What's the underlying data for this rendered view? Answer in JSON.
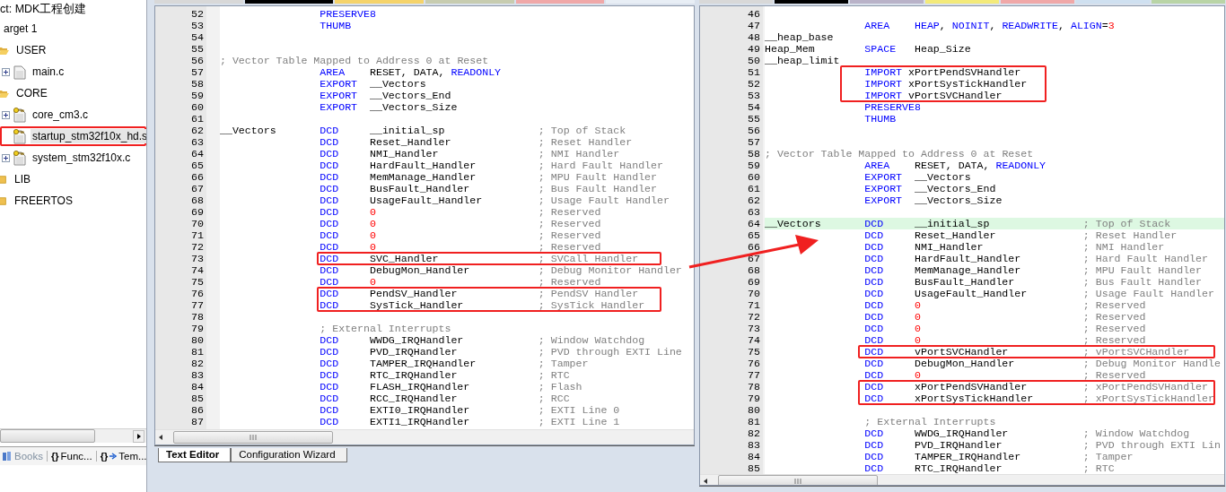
{
  "project": {
    "title": "ct: MDK工程创建",
    "tree": [
      {
        "label": "arget 1",
        "selected": false,
        "marked": false,
        "children": [
          {
            "label": "USER",
            "kind": "folder",
            "expanded": true,
            "selected": false,
            "marked": false,
            "children": [
              {
                "label": "main.c",
                "kind": "file",
                "expandable": true,
                "selected": false,
                "marked": false
              }
            ]
          },
          {
            "label": "CORE",
            "kind": "folder",
            "expanded": true,
            "selected": false,
            "marked": false,
            "children": [
              {
                "label": "core_cm3.c",
                "kind": "keyed_file",
                "expandable": true,
                "selected": false,
                "marked": false
              },
              {
                "label": "startup_stm32f10x_hd.s",
                "kind": "keyed_file",
                "expandable": false,
                "selected": true,
                "marked": true
              },
              {
                "label": "system_stm32f10x.c",
                "kind": "keyed_file",
                "expandable": true,
                "selected": false,
                "marked": false
              }
            ]
          },
          {
            "label": "LIB",
            "kind": "folder",
            "expanded": false,
            "selected": false,
            "marked": false
          },
          {
            "label": "FREERTOS",
            "kind": "folder",
            "expanded": false,
            "selected": false,
            "marked": false
          }
        ]
      }
    ],
    "tabs": [
      {
        "label": "Books",
        "kind": "books"
      },
      {
        "label": "Func...",
        "kind": "functions",
        "glyph": "{}"
      },
      {
        "label": "Tem...",
        "kind": "templates",
        "glyph": "{}"
      }
    ]
  },
  "editors": [
    {
      "file_tabs": [
        {
          "color": "#d8d8d8"
        },
        {
          "color": "#000000"
        },
        {
          "color": "#f5d36a"
        },
        {
          "color": "#c7ccb0"
        },
        {
          "color": "#f0a8a8"
        },
        {
          "color": "#e8eef5"
        }
      ],
      "lines": [
        {
          "num": "52",
          "kind": "code",
          "op": "PRESERVE8",
          "selected": false,
          "marked": false
        },
        {
          "num": "53",
          "kind": "code",
          "op": "THUMB",
          "selected": false,
          "marked": false
        },
        {
          "num": "54",
          "kind": "code",
          "selected": false,
          "marked": false
        },
        {
          "num": "55",
          "kind": "code",
          "selected": false,
          "marked": false
        },
        {
          "num": "56",
          "kind": "note",
          "comment": "; Vector Table Mapped to Address 0 at Reset",
          "selected": false,
          "marked": false
        },
        {
          "num": "57",
          "kind": "code",
          "op": "AREA",
          "args": [
            {
              "text": "RESET, DATA, ",
              "kind": "plain"
            },
            {
              "text": "READONLY",
              "kind": "keyword"
            }
          ],
          "selected": false,
          "marked": false
        },
        {
          "num": "58",
          "kind": "code",
          "op": "EXPORT",
          "args": [
            {
              "text": "__Vectors",
              "kind": "plain"
            }
          ],
          "selected": false,
          "marked": false
        },
        {
          "num": "59",
          "kind": "code",
          "op": "EXPORT",
          "args": [
            {
              "text": "__Vectors_End",
              "kind": "plain"
            }
          ],
          "selected": false,
          "marked": false
        },
        {
          "num": "60",
          "kind": "code",
          "op": "EXPORT",
          "args": [
            {
              "text": "__Vectors_Size",
              "kind": "plain"
            }
          ],
          "selected": false,
          "marked": false
        },
        {
          "num": "61",
          "kind": "code",
          "selected": false,
          "marked": false
        },
        {
          "num": "62",
          "kind": "code",
          "label": "__Vectors",
          "op": "DCD",
          "args": [
            {
              "text": "__initial_sp",
              "kind": "plain"
            }
          ],
          "comment": "; Top of Stack",
          "selected": false,
          "marked": false
        },
        {
          "num": "63",
          "kind": "code",
          "op": "DCD",
          "args": [
            {
              "text": "Reset_Handler",
              "kind": "plain"
            }
          ],
          "comment": "; Reset Handler",
          "selected": false,
          "marked": false
        },
        {
          "num": "64",
          "kind": "code",
          "op": "DCD",
          "args": [
            {
              "text": "NMI_Handler",
              "kind": "plain"
            }
          ],
          "comment": "; NMI Handler",
          "selected": false,
          "marked": false
        },
        {
          "num": "65",
          "kind": "code",
          "op": "DCD",
          "args": [
            {
              "text": "HardFault_Handler",
              "kind": "plain"
            }
          ],
          "comment": "; Hard Fault Handler",
          "selected": false,
          "marked": false
        },
        {
          "num": "66",
          "kind": "code",
          "op": "DCD",
          "args": [
            {
              "text": "MemManage_Handler",
              "kind": "plain"
            }
          ],
          "comment": "; MPU Fault Handler",
          "selected": false,
          "marked": false
        },
        {
          "num": "67",
          "kind": "code",
          "op": "DCD",
          "args": [
            {
              "text": "BusFault_Handler",
              "kind": "plain"
            }
          ],
          "comment": "; Bus Fault Handler",
          "selected": false,
          "marked": false
        },
        {
          "num": "68",
          "kind": "code",
          "op": "DCD",
          "args": [
            {
              "text": "UsageFault_Handler",
              "kind": "plain"
            }
          ],
          "comment": "; Usage Fault Handler",
          "selected": false,
          "marked": false
        },
        {
          "num": "69",
          "kind": "code",
          "op": "DCD",
          "args": [
            {
              "text": "0",
              "kind": "number"
            }
          ],
          "comment": "; Reserved",
          "selected": false,
          "marked": false
        },
        {
          "num": "70",
          "kind": "code",
          "op": "DCD",
          "args": [
            {
              "text": "0",
              "kind": "number"
            }
          ],
          "comment": "; Reserved",
          "selected": false,
          "marked": false
        },
        {
          "num": "71",
          "kind": "code",
          "op": "DCD",
          "args": [
            {
              "text": "0",
              "kind": "number"
            }
          ],
          "comment": "; Reserved",
          "selected": false,
          "marked": false
        },
        {
          "num": "72",
          "kind": "code",
          "op": "DCD",
          "args": [
            {
              "text": "0",
              "kind": "number"
            }
          ],
          "comment": "; Reserved",
          "selected": false,
          "marked": false
        },
        {
          "num": "73",
          "kind": "code",
          "op": "DCD",
          "args": [
            {
              "text": "SVC_Handler",
              "kind": "plain"
            }
          ],
          "comment": "; SVCall Handler",
          "selected": false,
          "marked": true
        },
        {
          "num": "74",
          "kind": "code",
          "op": "DCD",
          "args": [
            {
              "text": "DebugMon_Handler",
              "kind": "plain"
            }
          ],
          "comment": "; Debug Monitor Handler",
          "selected": false,
          "marked": false
        },
        {
          "num": "75",
          "kind": "code",
          "op": "DCD",
          "args": [
            {
              "text": "0",
              "kind": "number"
            }
          ],
          "comment": "; Reserved",
          "selected": false,
          "marked": false
        },
        {
          "num": "76",
          "kind": "code",
          "op": "DCD",
          "args": [
            {
              "text": "PendSV_Handler",
              "kind": "plain"
            }
          ],
          "comment": "; PendSV Handler",
          "selected": false,
          "marked": true
        },
        {
          "num": "77",
          "kind": "code",
          "op": "DCD",
          "args": [
            {
              "text": "SysTick_Handler",
              "kind": "plain"
            }
          ],
          "comment": "; SysTick Handler",
          "selected": false,
          "marked": true
        },
        {
          "num": "78",
          "kind": "code",
          "selected": false,
          "marked": false
        },
        {
          "num": "79",
          "kind": "indented_note",
          "comment": "; External Interrupts",
          "selected": false,
          "marked": false
        },
        {
          "num": "80",
          "kind": "code",
          "op": "DCD",
          "args": [
            {
              "text": "WWDG_IRQHandler",
              "kind": "plain"
            }
          ],
          "comment": "; Window Watchdog",
          "selected": false,
          "marked": false
        },
        {
          "num": "81",
          "kind": "code",
          "op": "DCD",
          "args": [
            {
              "text": "PVD_IRQHandler",
              "kind": "plain"
            }
          ],
          "comment": "; PVD through EXTI Line",
          "selected": false,
          "marked": false
        },
        {
          "num": "82",
          "kind": "code",
          "op": "DCD",
          "args": [
            {
              "text": "TAMPER_IRQHandler",
              "kind": "plain"
            }
          ],
          "comment": "; Tamper",
          "selected": false,
          "marked": false
        },
        {
          "num": "83",
          "kind": "code",
          "op": "DCD",
          "args": [
            {
              "text": "RTC_IRQHandler",
              "kind": "plain"
            }
          ],
          "comment": "; RTC",
          "selected": false,
          "marked": false
        },
        {
          "num": "84",
          "kind": "code",
          "op": "DCD",
          "args": [
            {
              "text": "FLASH_IRQHandler",
              "kind": "plain"
            }
          ],
          "comment": "; Flash",
          "selected": false,
          "marked": false
        },
        {
          "num": "85",
          "kind": "code",
          "op": "DCD",
          "args": [
            {
              "text": "RCC_IRQHandler",
              "kind": "plain"
            }
          ],
          "comment": "; RCC",
          "selected": false,
          "marked": false
        },
        {
          "num": "86",
          "kind": "code",
          "op": "DCD",
          "args": [
            {
              "text": "EXTI0_IRQHandler",
              "kind": "plain"
            }
          ],
          "comment": "; EXTI Line 0",
          "selected": false,
          "marked": false
        },
        {
          "num": "87",
          "kind": "code",
          "op": "DCD",
          "args": [
            {
              "text": "EXTI1_IRQHandler",
              "kind": "plain"
            }
          ],
          "comment": "; EXTI Line 1",
          "selected": false,
          "marked": false
        }
      ],
      "tabs": [
        {
          "label": "Text Editor",
          "selected": true
        },
        {
          "label": "Configuration Wizard",
          "selected": false
        }
      ]
    },
    {
      "file_tabs": [
        {
          "color": "#d8d8d8"
        },
        {
          "color": "#000000"
        },
        {
          "color": "#b9b2c8"
        },
        {
          "color": "#f3ea7a"
        },
        {
          "color": "#f0a8a8"
        },
        {
          "color": "#cfe0f0"
        },
        {
          "color": "#b9d4a6"
        }
      ],
      "lines": [
        {
          "num": "46",
          "kind": "code",
          "selected": false,
          "marked": false
        },
        {
          "num": "47",
          "kind": "code",
          "op": "AREA",
          "args": [
            {
              "text": "HEAP",
              "kind": "keyword"
            },
            {
              "text": ", ",
              "kind": "plain"
            },
            {
              "text": "NOINIT",
              "kind": "keyword"
            },
            {
              "text": ", ",
              "kind": "plain"
            },
            {
              "text": "READWRITE",
              "kind": "keyword"
            },
            {
              "text": ", ",
              "kind": "plain"
            },
            {
              "text": "ALIGN",
              "kind": "keyword"
            },
            {
              "text": "=",
              "kind": "plain"
            },
            {
              "text": "3",
              "kind": "number"
            }
          ],
          "selected": false,
          "marked": false
        },
        {
          "num": "48",
          "kind": "code",
          "label": "__heap_base",
          "selected": false,
          "marked": false
        },
        {
          "num": "49",
          "kind": "code",
          "label": "Heap_Mem",
          "op": "SPACE",
          "args": [
            {
              "text": "Heap_Size",
              "kind": "plain"
            }
          ],
          "selected": false,
          "marked": false
        },
        {
          "num": "50",
          "kind": "code",
          "label": "__heap_limit",
          "selected": false,
          "marked": false
        },
        {
          "num": "51",
          "kind": "import",
          "op": "IMPORT",
          "args": [
            {
              "text": "xPortPendSVHandler",
              "kind": "plain"
            }
          ],
          "selected": false,
          "marked": true
        },
        {
          "num": "52",
          "kind": "import",
          "op": "IMPORT",
          "args": [
            {
              "text": "xPortSysTickHandler",
              "kind": "plain"
            }
          ],
          "selected": false,
          "marked": true
        },
        {
          "num": "53",
          "kind": "import",
          "op": "IMPORT",
          "args": [
            {
              "text": "vPortSVCHandler",
              "kind": "plain"
            }
          ],
          "selected": false,
          "marked": true
        },
        {
          "num": "54",
          "kind": "code",
          "op": "PRESERVE8",
          "selected": false,
          "marked": false
        },
        {
          "num": "55",
          "kind": "code",
          "op": "THUMB",
          "selected": false,
          "marked": false
        },
        {
          "num": "56",
          "kind": "code",
          "selected": false,
          "marked": false
        },
        {
          "num": "57",
          "kind": "code",
          "selected": false,
          "marked": false
        },
        {
          "num": "58",
          "kind": "note",
          "comment": "; Vector Table Mapped to Address 0 at Reset",
          "selected": false,
          "marked": false
        },
        {
          "num": "59",
          "kind": "code",
          "op": "AREA",
          "args": [
            {
              "text": "RESET, DATA, ",
              "kind": "plain"
            },
            {
              "text": "READONLY",
              "kind": "keyword"
            }
          ],
          "selected": false,
          "marked": false
        },
        {
          "num": "60",
          "kind": "code",
          "op": "EXPORT",
          "args": [
            {
              "text": "__Vectors",
              "kind": "plain"
            }
          ],
          "selected": false,
          "marked": false
        },
        {
          "num": "61",
          "kind": "code",
          "op": "EXPORT",
          "args": [
            {
              "text": "__Vectors_End",
              "kind": "plain"
            }
          ],
          "selected": false,
          "marked": false
        },
        {
          "num": "62",
          "kind": "code",
          "op": "EXPORT",
          "args": [
            {
              "text": "__Vectors_Size",
              "kind": "plain"
            }
          ],
          "selected": false,
          "marked": false
        },
        {
          "num": "63",
          "kind": "code",
          "selected": false,
          "marked": false
        },
        {
          "num": "64",
          "kind": "code",
          "label": "__Vectors",
          "op": "DCD",
          "args": [
            {
              "text": "__initial_sp",
              "kind": "plain"
            }
          ],
          "comment": "; Top of Stack",
          "selected": true,
          "marked": false
        },
        {
          "num": "65",
          "kind": "code",
          "op": "DCD",
          "args": [
            {
              "text": "Reset_Handler",
              "kind": "plain"
            }
          ],
          "comment": "; Reset Handler",
          "selected": false,
          "marked": false
        },
        {
          "num": "66",
          "kind": "code",
          "op": "DCD",
          "args": [
            {
              "text": "NMI_Handler",
              "kind": "plain"
            }
          ],
          "comment": "; NMI Handler",
          "selected": false,
          "marked": false
        },
        {
          "num": "67",
          "kind": "code",
          "op": "DCD",
          "args": [
            {
              "text": "HardFault_Handler",
              "kind": "plain"
            }
          ],
          "comment": "; Hard Fault Handler",
          "selected": false,
          "marked": false
        },
        {
          "num": "68",
          "kind": "code",
          "op": "DCD",
          "args": [
            {
              "text": "MemManage_Handler",
              "kind": "plain"
            }
          ],
          "comment": "; MPU Fault Handler",
          "selected": false,
          "marked": false
        },
        {
          "num": "69",
          "kind": "code",
          "op": "DCD",
          "args": [
            {
              "text": "BusFault_Handler",
              "kind": "plain"
            }
          ],
          "comment": "; Bus Fault Handler",
          "selected": false,
          "marked": false
        },
        {
          "num": "70",
          "kind": "code",
          "op": "DCD",
          "args": [
            {
              "text": "UsageFault_Handler",
              "kind": "plain"
            }
          ],
          "comment": "; Usage Fault Handler",
          "selected": false,
          "marked": false
        },
        {
          "num": "71",
          "kind": "code",
          "op": "DCD",
          "args": [
            {
              "text": "0",
              "kind": "number"
            }
          ],
          "comment": "; Reserved",
          "selected": false,
          "marked": false
        },
        {
          "num": "72",
          "kind": "code",
          "op": "DCD",
          "args": [
            {
              "text": "0",
              "kind": "number"
            }
          ],
          "comment": "; Reserved",
          "selected": false,
          "marked": false
        },
        {
          "num": "73",
          "kind": "code",
          "op": "DCD",
          "args": [
            {
              "text": "0",
              "kind": "number"
            }
          ],
          "comment": "; Reserved",
          "selected": false,
          "marked": false
        },
        {
          "num": "74",
          "kind": "code",
          "op": "DCD",
          "args": [
            {
              "text": "0",
              "kind": "number"
            }
          ],
          "comment": "; Reserved",
          "selected": false,
          "marked": false
        },
        {
          "num": "75",
          "kind": "code",
          "op": "DCD",
          "args": [
            {
              "text": "vPortSVCHandler",
              "kind": "plain"
            }
          ],
          "comment": "; vPortSVCHandler",
          "selected": false,
          "marked": true
        },
        {
          "num": "76",
          "kind": "code",
          "op": "DCD",
          "args": [
            {
              "text": "DebugMon_Handler",
              "kind": "plain"
            }
          ],
          "comment": "; Debug Monitor Handle",
          "selected": false,
          "marked": false
        },
        {
          "num": "77",
          "kind": "code",
          "op": "DCD",
          "args": [
            {
              "text": "0",
              "kind": "number"
            }
          ],
          "comment": "; Reserved",
          "selected": false,
          "marked": false
        },
        {
          "num": "78",
          "kind": "code",
          "op": "DCD",
          "args": [
            {
              "text": "xPortPendSVHandler",
              "kind": "plain"
            }
          ],
          "comment": "; xPortPendSVHandler",
          "selected": false,
          "marked": true
        },
        {
          "num": "79",
          "kind": "code",
          "op": "DCD",
          "args": [
            {
              "text": "xPortSysTickHandler",
              "kind": "plain"
            }
          ],
          "comment": "; xPortSysTickHandler",
          "selected": false,
          "marked": true
        },
        {
          "num": "80",
          "kind": "code",
          "selected": false,
          "marked": false
        },
        {
          "num": "81",
          "kind": "indented_note",
          "comment": "; External Interrupts",
          "selected": false,
          "marked": false
        },
        {
          "num": "82",
          "kind": "code",
          "op": "DCD",
          "args": [
            {
              "text": "WWDG_IRQHandler",
              "kind": "plain"
            }
          ],
          "comment": "; Window Watchdog",
          "selected": false,
          "marked": false
        },
        {
          "num": "83",
          "kind": "code",
          "op": "DCD",
          "args": [
            {
              "text": "PVD_IRQHandler",
              "kind": "plain"
            }
          ],
          "comment": "; PVD through EXTI Lin",
          "selected": false,
          "marked": false
        },
        {
          "num": "84",
          "kind": "code",
          "op": "DCD",
          "args": [
            {
              "text": "TAMPER_IRQHandler",
              "kind": "plain"
            }
          ],
          "comment": "; Tamper",
          "selected": false,
          "marked": false
        },
        {
          "num": "85",
          "kind": "code",
          "op": "DCD",
          "args": [
            {
              "text": "RTC_IRQHandler",
              "kind": "plain"
            }
          ],
          "comment": "; RTC",
          "selected": false,
          "marked": false
        }
      ]
    }
  ]
}
